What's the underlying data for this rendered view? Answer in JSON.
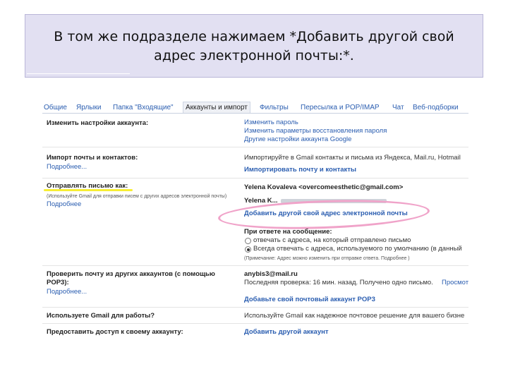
{
  "slide": {
    "title_line1": "В том же подразделе нажимаем *Добавить другой свой",
    "title_line2": "адрес электронной почты:*."
  },
  "tabs": [
    "Общие",
    "Ярлыки",
    "Папка \"Входящие\"",
    "Аккаунты и импорт",
    "Фильтры",
    "Пересылка и POP/IMAP",
    "Чат",
    "Веб-подборки"
  ],
  "account": {
    "label": "Изменить настройки аккаунта:",
    "links": [
      "Изменить пароль",
      "Изменить параметры восстановления пароля",
      "Другие настройки аккаунта Google"
    ]
  },
  "import": {
    "label": "Импорт почты и контактов:",
    "more": "Подробнее...",
    "desc": "Импортируйте в Gmail контакты и письма из Яндекса, Mail.ru, Hotmail",
    "action": "Импортировать почту и контакты"
  },
  "send_as": {
    "label": "Отправлять письмо как:",
    "hint": "(Используйте Gmail для отправки писем с других адресов электронной почты)",
    "more": "Подробнее",
    "address1": "Yelena Kovaleva <overcomeesthetic@gmail.com>",
    "address2": "Yelena K...",
    "add_link": "Добавить другой свой адрес электронной почты",
    "reply_label": "При ответе на сообщение:",
    "option1": "отвечать с адреса, на который отправлено письмо",
    "option2": "Всегда отвечать с адреса, используемого по умолчанию (в данный",
    "note": "(Примечание: Адрес можно изменить при отправке ответа.  Подробнее )"
  },
  "check_mail": {
    "label": "Проверить почту из других аккаунтов (с помощью",
    "label2": "POP3):",
    "more": "Подробнее...",
    "account": "anybis3@mail.ru",
    "last_check": "Последняя проверка: 16 мин. назад. Получено одно письмо.",
    "view_history": "Просмотр",
    "add_action": "Добавьте свой почтовый аккаунт POP3"
  },
  "work": {
    "label": "Используете Gmail для работы?",
    "desc": "Используйте Gmail как надежное почтовое решение для вашего бизне"
  },
  "grant": {
    "label": "Предоставить доступ к своему аккаунту:",
    "action": "Добавить другой аккаунт"
  },
  "colors": {
    "highlight_ellipse": "#f0a3c9",
    "highlight_underline": "#f7ee34",
    "link": "#2a5db0",
    "title_bg": "#e2e0f2"
  }
}
